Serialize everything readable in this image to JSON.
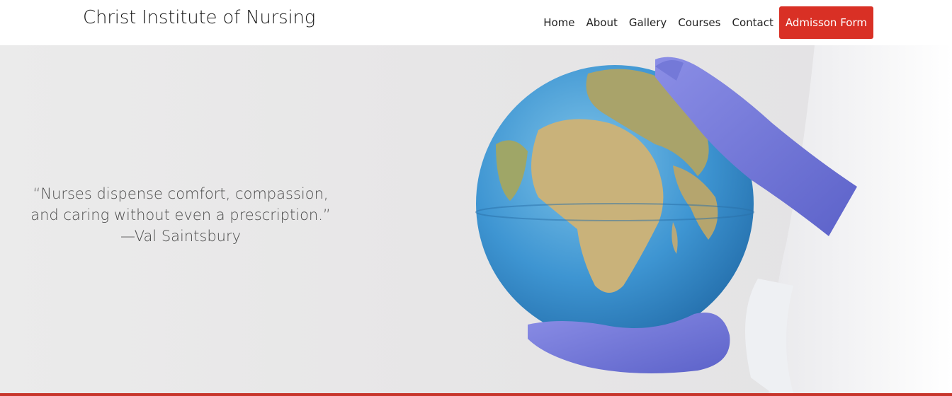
{
  "brand": {
    "title": "Christ Institute of Nursing"
  },
  "nav": {
    "items": [
      {
        "label": "Home"
      },
      {
        "label": "About"
      },
      {
        "label": "Gallery"
      },
      {
        "label": "Courses"
      },
      {
        "label": "Contact"
      }
    ],
    "cta_label": "Admisson Form",
    "cta_color": "#d93025"
  },
  "hero": {
    "quote_line1": "“Nurses dispense comfort, compassion,",
    "quote_line2": "and caring without even a prescription.”",
    "quote_author": "—Val Saintsbury"
  },
  "colors": {
    "accent": "#d93025",
    "footer_bar": "#c7352b"
  }
}
